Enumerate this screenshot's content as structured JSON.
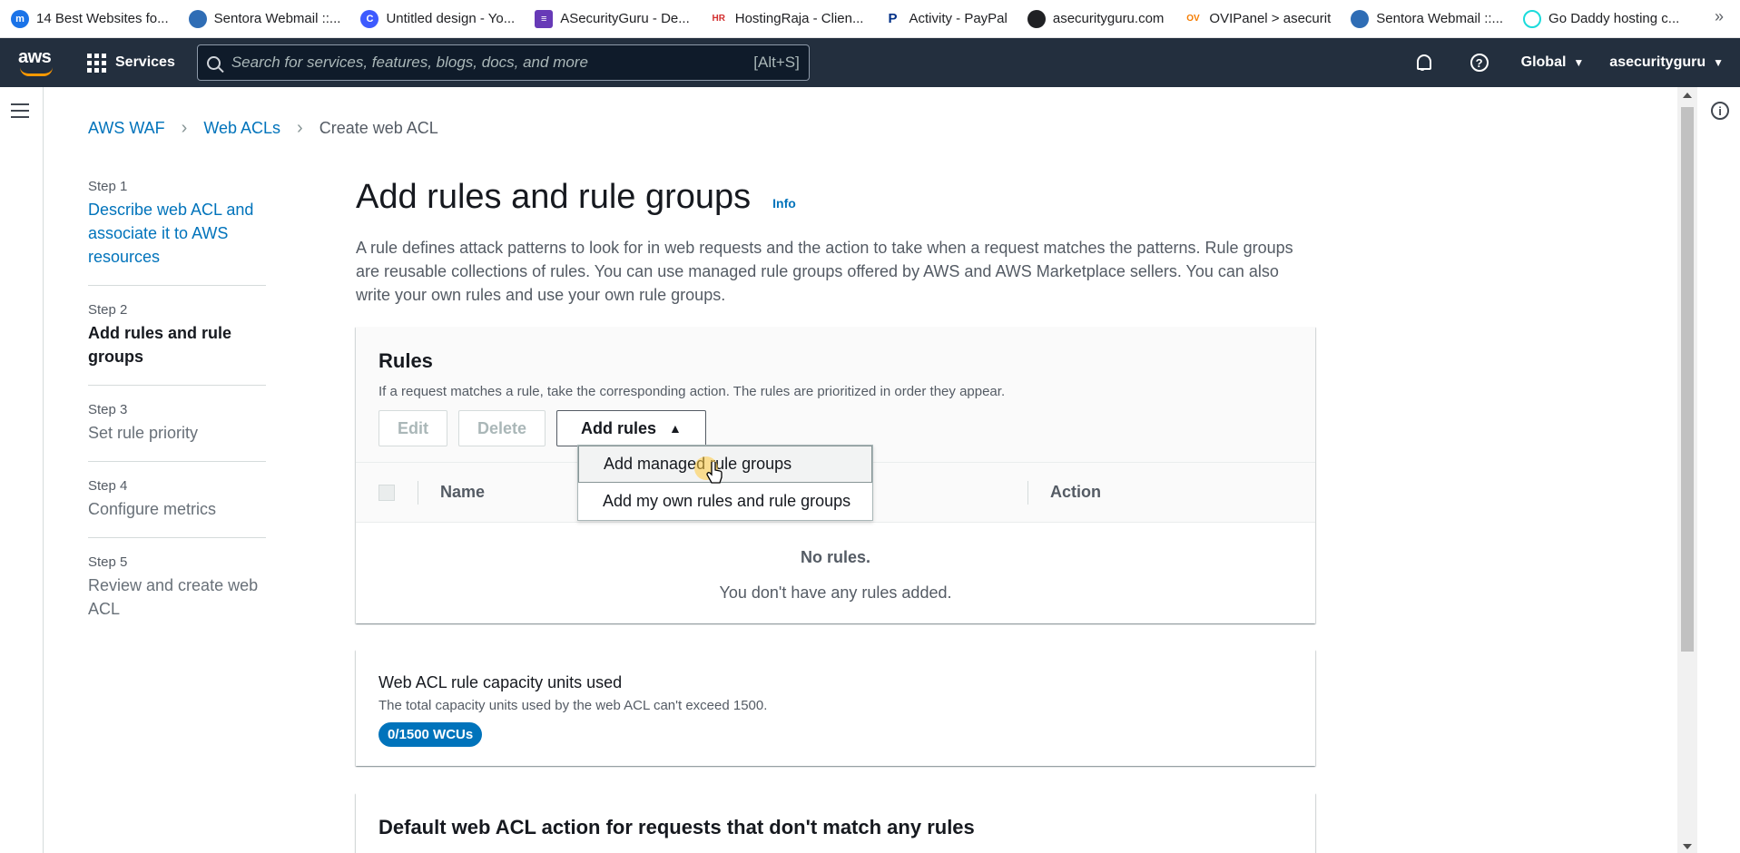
{
  "bookmarks": [
    {
      "label": "14 Best Websites fo...",
      "icon": "m-icon",
      "color": "#1a73e8",
      "glyph": "m"
    },
    {
      "label": "Sentora Webmail ::...",
      "icon": "globe-icon",
      "color": "#2f6db5",
      "glyph": ""
    },
    {
      "label": "Untitled design - Yo...",
      "icon": "canva-icon",
      "color": "#3d5afe",
      "glyph": "C"
    },
    {
      "label": "ASecurityGuru - De...",
      "icon": "forms-icon",
      "color": "#673ab7",
      "glyph": "≡"
    },
    {
      "label": "HostingRaja - Clien...",
      "icon": "hr-icon",
      "color": "#d32f2f",
      "glyph": "HR"
    },
    {
      "label": "Activity - PayPal",
      "icon": "paypal-icon",
      "color": "#003087",
      "glyph": "P"
    },
    {
      "label": "asecurityguru.com",
      "icon": "web-icon",
      "color": "#202124",
      "glyph": ""
    },
    {
      "label": "OVIPanel > asecurit",
      "icon": "ovi-icon",
      "color": "#f57c00",
      "glyph": "OV"
    },
    {
      "label": "Sentora Webmail ::...",
      "icon": "globe-icon",
      "color": "#2f6db5",
      "glyph": ""
    },
    {
      "label": "Go Daddy hosting c...",
      "icon": "godaddy-icon",
      "color": "#1bdbdb",
      "glyph": "G"
    }
  ],
  "bookmarks_more": "»",
  "topnav": {
    "logo": "aws",
    "services": "Services",
    "search_placeholder": "Search for services, features, blogs, docs, and more",
    "search_shortcut": "[Alt+S]",
    "region": "Global",
    "account": "asecurityguru"
  },
  "breadcrumb": {
    "item1": "AWS WAF",
    "item2": "Web ACLs",
    "current": "Create web ACL"
  },
  "steps": [
    {
      "num": "Step 1",
      "title": "Describe web ACL and associate it to AWS resources"
    },
    {
      "num": "Step 2",
      "title": "Add rules and rule groups"
    },
    {
      "num": "Step 3",
      "title": "Set rule priority"
    },
    {
      "num": "Step 4",
      "title": "Configure metrics"
    },
    {
      "num": "Step 5",
      "title": "Review and create web ACL"
    }
  ],
  "main": {
    "title": "Add rules and rule groups",
    "info": "Info",
    "description": "A rule defines attack patterns to look for in web requests and the action to take when a request matches the patterns. Rule groups are reusable collections of rules. You can use managed rule groups offered by AWS and AWS Marketplace sellers. You can also write your own rules and use your own rule groups."
  },
  "rules": {
    "title": "Rules",
    "subtitle": "If a request matches a rule, take the corresponding action. The rules are prioritized in order they appear.",
    "edit": "Edit",
    "delete": "Delete",
    "add_rules": "Add rules",
    "col_name": "Name",
    "col_action": "Action",
    "empty_title": "No rules.",
    "empty_sub": "You don't have any rules added.",
    "menu": [
      "Add managed rule groups",
      "Add my own rules and rule groups"
    ]
  },
  "capacity": {
    "title": "Web ACL rule capacity units used",
    "subtitle": "The total capacity units used by the web ACL can't exceed 1500.",
    "badge": "0/1500 WCUs"
  },
  "default_action": {
    "title": "Default web ACL action for requests that don't match any rules"
  },
  "colors": {
    "nav_bg": "#232f3e",
    "link": "#0073bb",
    "accent": "#ff9900"
  }
}
